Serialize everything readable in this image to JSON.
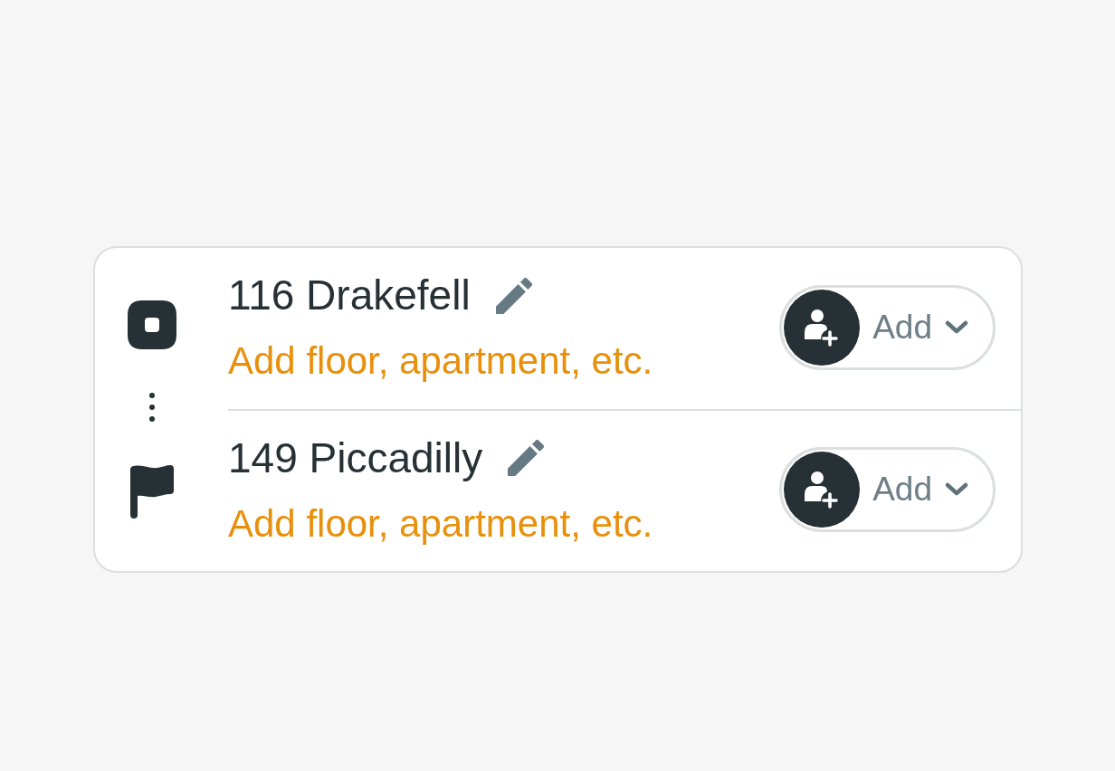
{
  "stops": [
    {
      "kind": "origin",
      "address": "116 Drakefell",
      "detail_link": "Add floor, apartment, etc.",
      "action": {
        "label": "Add"
      }
    },
    {
      "kind": "destination",
      "address": "149 Piccadilly",
      "detail_link": "Add floor, apartment, etc.",
      "action": {
        "label": "Add"
      }
    }
  ]
}
